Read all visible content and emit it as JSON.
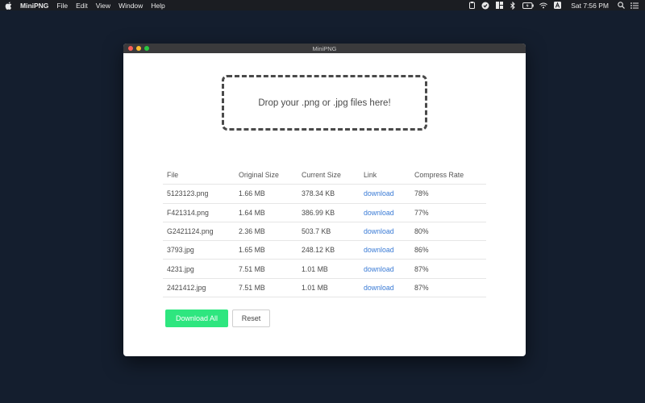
{
  "menubar": {
    "app_name": "MiniPNG",
    "items": [
      "File",
      "Edit",
      "View",
      "Window",
      "Help"
    ],
    "clock": "Sat 7:56 PM",
    "status_icons": [
      "clipboard-icon",
      "circle-app-icon",
      "grid-icon",
      "bluetooth-icon",
      "battery-icon",
      "wifi-icon",
      "input-source-icon"
    ]
  },
  "window": {
    "title": "MiniPNG"
  },
  "dropzone": {
    "text": "Drop your .png or .jpg files here!"
  },
  "table": {
    "headers": [
      "File",
      "Original Size",
      "Current Size",
      "Link",
      "Compress Rate"
    ],
    "rows": [
      {
        "file": "5123123.png",
        "original": "1.66 MB",
        "current": "378.34 KB",
        "link": "download",
        "rate": "78%"
      },
      {
        "file": "F421314.png",
        "original": "1.64 MB",
        "current": "386.99 KB",
        "link": "download",
        "rate": "77%"
      },
      {
        "file": "G2421124.png",
        "original": "2.36 MB",
        "current": "503.7 KB",
        "link": "download",
        "rate": "80%"
      },
      {
        "file": "3793.jpg",
        "original": "1.65 MB",
        "current": "248.12 KB",
        "link": "download",
        "rate": "86%"
      },
      {
        "file": "4231.jpg",
        "original": "7.51 MB",
        "current": "1.01 MB",
        "link": "download",
        "rate": "87%"
      },
      {
        "file": "2421412.jpg",
        "original": "7.51 MB",
        "current": "1.01 MB",
        "link": "download",
        "rate": "87%"
      }
    ]
  },
  "actions": {
    "download_all": "Download All",
    "reset": "Reset"
  },
  "colors": {
    "desktop": "#141e2e",
    "accent_green": "#2ee67f",
    "link_blue": "#3a7bd5"
  }
}
